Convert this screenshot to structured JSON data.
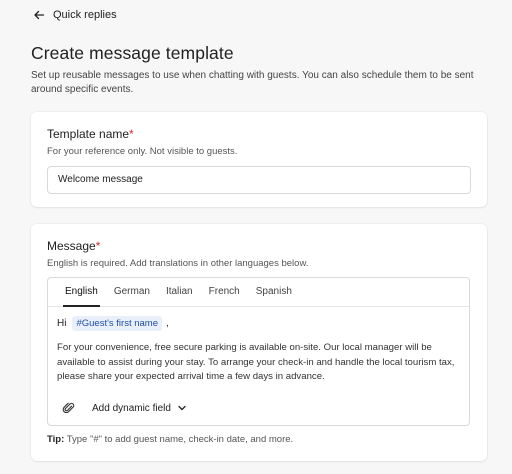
{
  "header": {
    "back_label": "Quick replies",
    "title": "Create message template",
    "description": "Set up reusable messages to use when chatting with guests. You can also schedule them to be sent around specific events."
  },
  "template_name": {
    "label": "Template name",
    "required_mark": "*",
    "help": "For your reference only. Not visible to guests.",
    "value": "Welcome message"
  },
  "message": {
    "label": "Message",
    "required_mark": "*",
    "help": "English is required. Add translations in other languages below.",
    "tabs": [
      {
        "label": "English",
        "active": true
      },
      {
        "label": "German",
        "active": false
      },
      {
        "label": "Italian",
        "active": false
      },
      {
        "label": "French",
        "active": false
      },
      {
        "label": "Spanish",
        "active": false
      }
    ],
    "greeting_word": "Hi",
    "dynamic_chip": "#Guest's first name",
    "greeting_suffix": ",",
    "body": "For your convenience, free secure parking is available on-site. Our local manager will be available to assist during your stay. To arrange your check-in and handle the local tourism tax, please share your expected arrival time a few days in advance.",
    "add_dynamic_field_label": "Add dynamic field",
    "tip_label": "Tip:",
    "tip_text": "Type \"#\" to add guest name, check-in date, and more."
  },
  "colors": {
    "background": "#f7f7f7",
    "card": "#ffffff",
    "required": "#d72b2b",
    "chip_bg": "#e9f0fb",
    "chip_text": "#1f4fa5"
  },
  "icons": {
    "back": "arrow-left-icon",
    "attach": "paperclip-icon",
    "dropdown": "chevron-down-icon"
  }
}
